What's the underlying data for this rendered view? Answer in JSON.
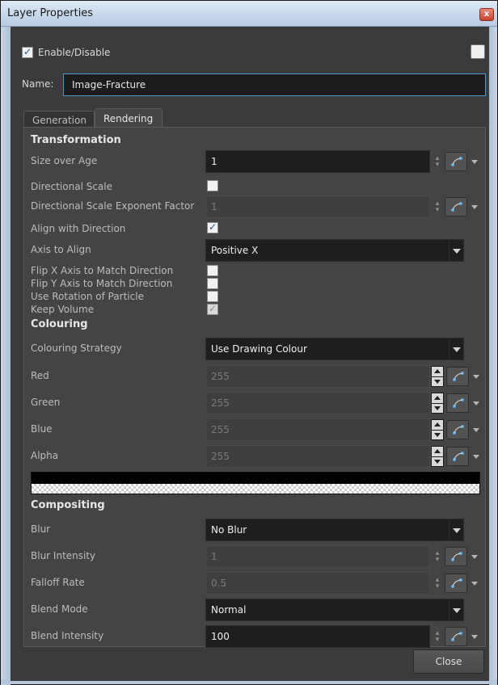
{
  "window": {
    "title": "Layer Properties",
    "close_glyph": "x"
  },
  "enable": {
    "label": "Enable/Disable",
    "checked": true
  },
  "name": {
    "label": "Name:",
    "value": "Image-Fracture"
  },
  "tabs": [
    {
      "label": "Generation",
      "active": false
    },
    {
      "label": "Rendering",
      "active": true
    }
  ],
  "transformation": {
    "heading": "Transformation",
    "size_over_age": {
      "label": "Size over Age",
      "value": "1"
    },
    "directional_scale": {
      "label": "Directional Scale",
      "checked": false
    },
    "dir_scale_exp": {
      "label": "Directional Scale Exponent Factor",
      "value": "1"
    },
    "align_with_direction": {
      "label": "Align with Direction",
      "checked": true
    },
    "axis_to_align": {
      "label": "Axis to Align",
      "value": "Positive X"
    },
    "flip_x": {
      "label": "Flip X Axis to Match Direction",
      "checked": false
    },
    "flip_y": {
      "label": "Flip Y Axis to Match Direction",
      "checked": false
    },
    "use_rotation": {
      "label": "Use Rotation of Particle",
      "checked": false
    },
    "keep_volume": {
      "label": "Keep Volume",
      "checked": true
    }
  },
  "colouring": {
    "heading": "Colouring",
    "strategy": {
      "label": "Colouring Strategy",
      "value": "Use Drawing Colour"
    },
    "red": {
      "label": "Red",
      "value": "255"
    },
    "green": {
      "label": "Green",
      "value": "255"
    },
    "blue": {
      "label": "Blue",
      "value": "255"
    },
    "alpha": {
      "label": "Alpha",
      "value": "255"
    }
  },
  "compositing": {
    "heading": "Compositing",
    "blur": {
      "label": "Blur",
      "value": "No Blur"
    },
    "blur_intensity": {
      "label": "Blur Intensity",
      "value": "1"
    },
    "falloff_rate": {
      "label": "Falloff Rate",
      "value": "0.5"
    },
    "blend_mode": {
      "label": "Blend Mode",
      "value": "Normal"
    },
    "blend_intensity": {
      "label": "Blend Intensity",
      "value": "100"
    }
  },
  "buttons": {
    "close": "Close"
  },
  "icons": {
    "function": "function-curve-icon",
    "dropdown": "chevron-down-icon"
  }
}
